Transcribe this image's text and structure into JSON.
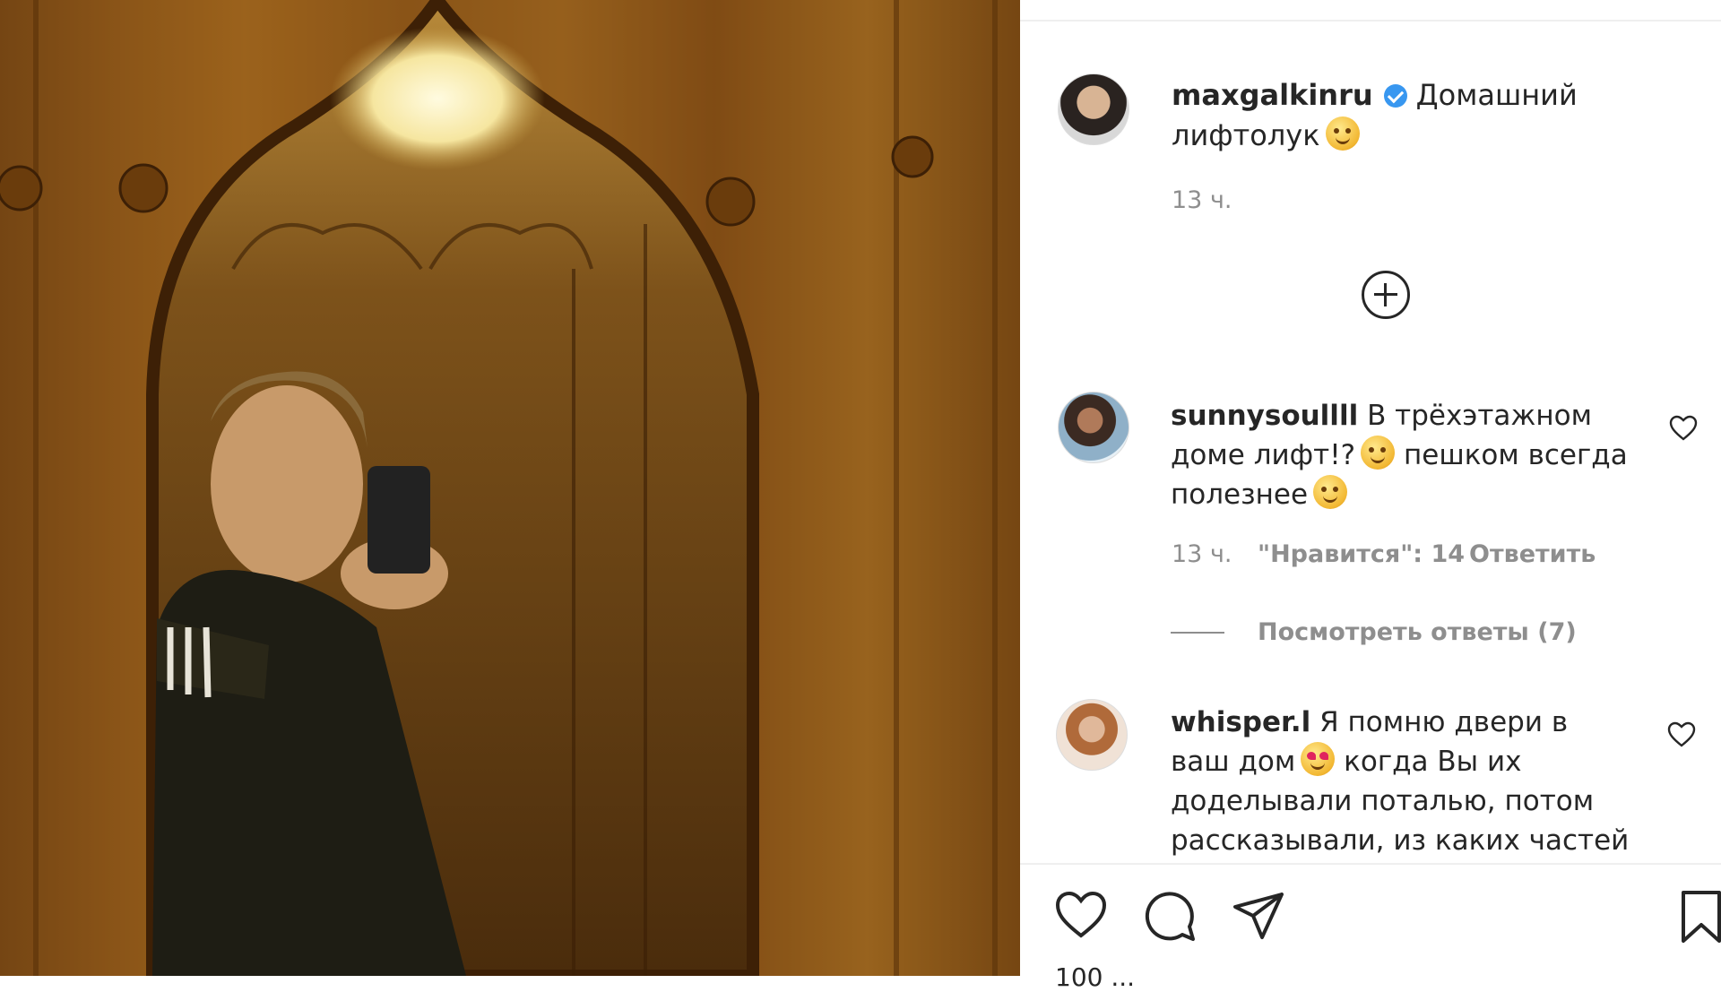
{
  "post": {
    "author": "maxgalkinru",
    "caption_text": "Домашний лифтолук",
    "time": "13 ч."
  },
  "comments": [
    {
      "username": "sunnysoullll",
      "text_line1": "В трёхэтажном",
      "text_line2": "доме лифт!?",
      "text_line2b": "пешком всегда",
      "text_line3": "полезнее",
      "time": "13 ч.",
      "likes": "\"Нравится\": 14",
      "reply": "Ответить",
      "view_replies": "Посмотреть ответы (7)"
    },
    {
      "username": "whisper.l",
      "text_line1": "Я помню двери в",
      "text_line2a": "ваш дом",
      "text_line2b": "когда Вы их",
      "text_line3": "доделывали поталью, потом",
      "text_line4": "рассказывали, из каких частей"
    }
  ],
  "footer": {
    "likes_partial": "100 ..."
  },
  "icons": {
    "verified": "verified-badge-icon",
    "add": "plus-circle-icon",
    "like": "heart-icon",
    "comment": "comment-icon",
    "share": "send-icon",
    "save": "bookmark-icon"
  },
  "colors": {
    "verified": "#3897f0",
    "text": "#262626",
    "muted": "#8e8e8e",
    "photo_wood": "#9d6520"
  }
}
